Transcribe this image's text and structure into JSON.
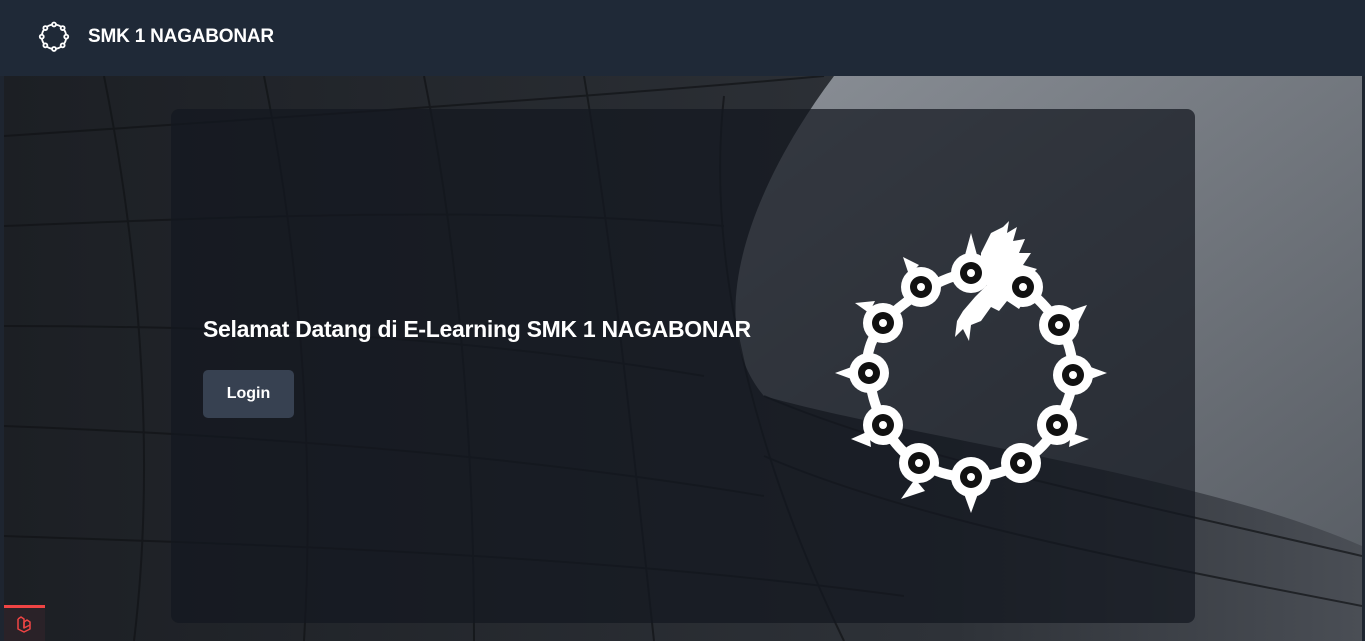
{
  "navbar": {
    "brand_name": "SMK 1 NAGABONAR",
    "logo_icon": "ouroboros-chain-icon"
  },
  "hero": {
    "title": "Selamat Datang di E-Learning SMK 1 NAGABONAR",
    "login_label": "Login",
    "emblem_icon": "ouroboros-chain-icon"
  },
  "debug_badge": {
    "icon": "laravel-icon"
  },
  "colors": {
    "navbar": "#1f2937",
    "button": "#374151",
    "badge_accent": "#ef4444"
  }
}
